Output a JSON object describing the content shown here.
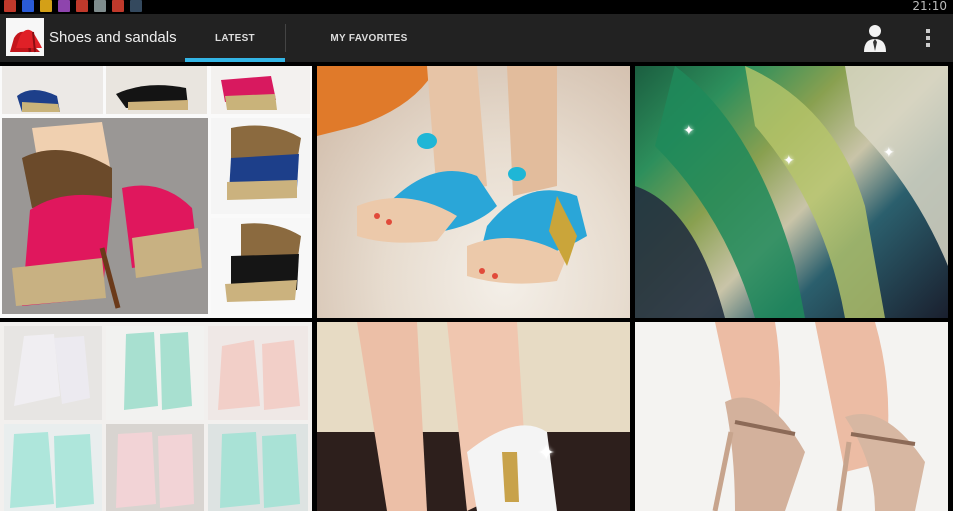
{
  "status_bar": {
    "time": "21:10",
    "notification_icons": [
      "#c0392b",
      "#2a5bd7",
      "#d4a017",
      "#8e44ad",
      "#c0392b",
      "#7f8c8d",
      "#c0392b",
      "#34495e"
    ]
  },
  "action_bar": {
    "app_title": "Shoes and sandals",
    "logo_icon": "red-high-heel-icon",
    "tabs": [
      {
        "label": "LATEST",
        "selected": true
      },
      {
        "label": "MY FAVORITES",
        "selected": false
      }
    ],
    "profile_icon": "person-icon",
    "overflow_icon": "overflow-menu-icon",
    "accent_color": "#33b5e5"
  },
  "gallery": {
    "tiles": [
      {
        "subject": "pink leopard heel collage"
      },
      {
        "subject": "blue jeweled sandals"
      },
      {
        "subject": "glitter green heels"
      },
      {
        "subject": "lace-up bootie collage"
      },
      {
        "subject": "white platform heel"
      },
      {
        "subject": "nude ankle strap heels"
      }
    ]
  }
}
